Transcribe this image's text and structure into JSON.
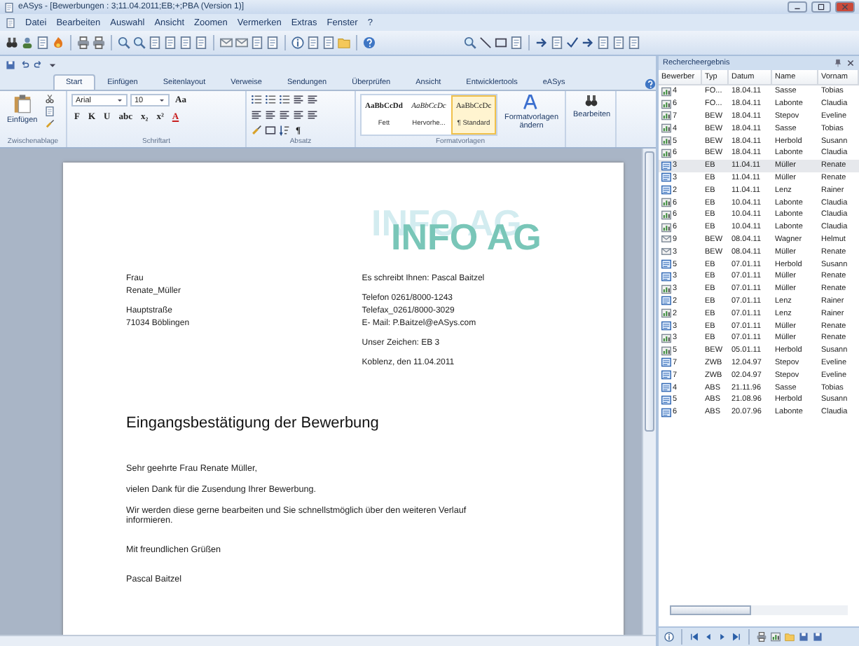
{
  "window": {
    "title": "eASys - [Bewerbungen : 3;11.04.2011;EB;+;PBA (Version 1)]"
  },
  "menu": [
    "Datei",
    "Bearbeiten",
    "Auswahl",
    "Ansicht",
    "Zoomen",
    "Vermerken",
    "Extras",
    "Fenster",
    "?"
  ],
  "ribbon": {
    "tabs": [
      {
        "label": "Start",
        "selected": true
      },
      {
        "label": "Einfügen",
        "selected": false
      },
      {
        "label": "Seitenlayout",
        "selected": false
      },
      {
        "label": "Verweise",
        "selected": false
      },
      {
        "label": "Sendungen",
        "selected": false
      },
      {
        "label": "Überprüfen",
        "selected": false
      },
      {
        "label": "Ansicht",
        "selected": false
      },
      {
        "label": "Entwicklertools",
        "selected": false
      },
      {
        "label": "eASys",
        "selected": false
      }
    ],
    "clipboard": {
      "label": "Zwischenablage",
      "paste": "Einfügen"
    },
    "font": {
      "label": "Schriftart",
      "font_name": "Arial",
      "font_size": "10",
      "case_button": "Aa",
      "buttons": [
        "F",
        "K",
        "U",
        "abc",
        "x₂",
        "x²"
      ],
      "color_button": "A"
    },
    "paragraph": {
      "label": "Absatz",
      "pilcrow": "¶"
    },
    "styles": {
      "label": "Formatvorlagen",
      "items": [
        {
          "preview": "AaBbCcDd",
          "label": "Fett",
          "selected": false
        },
        {
          "preview": "AaBbCcDc",
          "label": "Hervorhe...",
          "selected": false
        },
        {
          "preview": "AaBbCcDc",
          "label": "¶ Standard",
          "selected": true
        }
      ],
      "change": "Formatvorlagen ändern"
    },
    "editing": {
      "label": "Bearbeiten"
    }
  },
  "document": {
    "logo": "INFO AG",
    "recipient": [
      [
        "Frau",
        "Renate_Müller"
      ],
      [
        "Hauptstraße",
        "71034 Böblingen"
      ]
    ],
    "sender": [
      [
        "Es schreibt Ihnen: Pascal Baitzel"
      ],
      [
        "Telefon  0261/8000-1243",
        "Telefax_0261/8000-3029",
        "E- Mail: P.Baitzel@eASys.com"
      ],
      [
        "Unser Zeichen: EB 3"
      ],
      [
        "Koblenz, den 11.04.2011"
      ]
    ],
    "subject": "Eingangsbestätigung der Bewerbung",
    "body": [
      "Sehr geehrte Frau Renate Müller,",
      "vielen Dank für die Zusendung Ihrer Bewerbung.",
      "Wir werden diese gerne bearbeiten und Sie schnellstmöglich über den weiteren Verlauf informieren.",
      "Mit freundlichen Grüßen",
      "Pascal Baitzel"
    ]
  },
  "results": {
    "title": "Rechercheergebnis",
    "columns": [
      "Bewerber",
      "Typ",
      "Datum",
      "Name",
      "Vornam"
    ],
    "rows": [
      {
        "kind": "chart",
        "cells": [
          "4",
          "FO...",
          "18.04.11",
          "Sasse",
          "Tobias"
        ],
        "selected": false
      },
      {
        "kind": "chart",
        "cells": [
          "6",
          "FO...",
          "18.04.11",
          "Labonte",
          "Claudia"
        ],
        "selected": false
      },
      {
        "kind": "chart",
        "cells": [
          "7",
          "BEW",
          "18.04.11",
          "Stepov",
          "Eveline"
        ],
        "selected": false
      },
      {
        "kind": "chart",
        "cells": [
          "4",
          "BEW",
          "18.04.11",
          "Sasse",
          "Tobias"
        ],
        "selected": false
      },
      {
        "kind": "chart",
        "cells": [
          "5",
          "BEW",
          "18.04.11",
          "Herbold",
          "Susann"
        ],
        "selected": false
      },
      {
        "kind": "chart",
        "cells": [
          "6",
          "BEW",
          "18.04.11",
          "Labonte",
          "Claudia"
        ],
        "selected": false
      },
      {
        "kind": "letter",
        "cells": [
          "3",
          "EB",
          "11.04.11",
          "Müller",
          "Renate"
        ],
        "selected": true
      },
      {
        "kind": "letter",
        "cells": [
          "3",
          "EB",
          "11.04.11",
          "Müller",
          "Renate"
        ],
        "selected": false
      },
      {
        "kind": "letter",
        "cells": [
          "2",
          "EB",
          "11.04.11",
          "Lenz",
          "Rainer"
        ],
        "selected": false
      },
      {
        "kind": "chart",
        "cells": [
          "6",
          "EB",
          "10.04.11",
          "Labonte",
          "Claudia"
        ],
        "selected": false
      },
      {
        "kind": "chart",
        "cells": [
          "6",
          "EB",
          "10.04.11",
          "Labonte",
          "Claudia"
        ],
        "selected": false
      },
      {
        "kind": "chart",
        "cells": [
          "6",
          "EB",
          "10.04.11",
          "Labonte",
          "Claudia"
        ],
        "selected": false
      },
      {
        "kind": "mail",
        "cells": [
          "9",
          "BEW",
          "08.04.11",
          "Wagner",
          "Helmut"
        ],
        "selected": false
      },
      {
        "kind": "mail",
        "cells": [
          "3",
          "BEW",
          "08.04.11",
          "Müller",
          "Renate"
        ],
        "selected": false
      },
      {
        "kind": "letter",
        "cells": [
          "5",
          "EB",
          "07.01.11",
          "Herbold",
          "Susann"
        ],
        "selected": false
      },
      {
        "kind": "letter",
        "cells": [
          "3",
          "EB",
          "07.01.11",
          "Müller",
          "Renate"
        ],
        "selected": false
      },
      {
        "kind": "chart",
        "cells": [
          "3",
          "EB",
          "07.01.11",
          "Müller",
          "Renate"
        ],
        "selected": false
      },
      {
        "kind": "letter",
        "cells": [
          "2",
          "EB",
          "07.01.11",
          "Lenz",
          "Rainer"
        ],
        "selected": false
      },
      {
        "kind": "chart",
        "cells": [
          "2",
          "EB",
          "07.01.11",
          "Lenz",
          "Rainer"
        ],
        "selected": false
      },
      {
        "kind": "letter",
        "cells": [
          "3",
          "EB",
          "07.01.11",
          "Müller",
          "Renate"
        ],
        "selected": false
      },
      {
        "kind": "chart",
        "cells": [
          "3",
          "EB",
          "07.01.11",
          "Müller",
          "Renate"
        ],
        "selected": false
      },
      {
        "kind": "chart",
        "cells": [
          "5",
          "BEW",
          "05.01.11",
          "Herbold",
          "Susann"
        ],
        "selected": false
      },
      {
        "kind": "letter",
        "cells": [
          "7",
          "ZWB",
          "12.04.97",
          "Stepov",
          "Eveline"
        ],
        "selected": false
      },
      {
        "kind": "letter",
        "cells": [
          "7",
          "ZWB",
          "02.04.97",
          "Stepov",
          "Eveline"
        ],
        "selected": false
      },
      {
        "kind": "letter",
        "cells": [
          "4",
          "ABS",
          "21.11.96",
          "Sasse",
          "Tobias"
        ],
        "selected": false
      },
      {
        "kind": "letter",
        "cells": [
          "5",
          "ABS",
          "21.08.96",
          "Herbold",
          "Susann"
        ],
        "selected": false
      },
      {
        "kind": "letter",
        "cells": [
          "6",
          "ABS",
          "20.07.96",
          "Labonte",
          "Claudia"
        ],
        "selected": false
      }
    ]
  }
}
